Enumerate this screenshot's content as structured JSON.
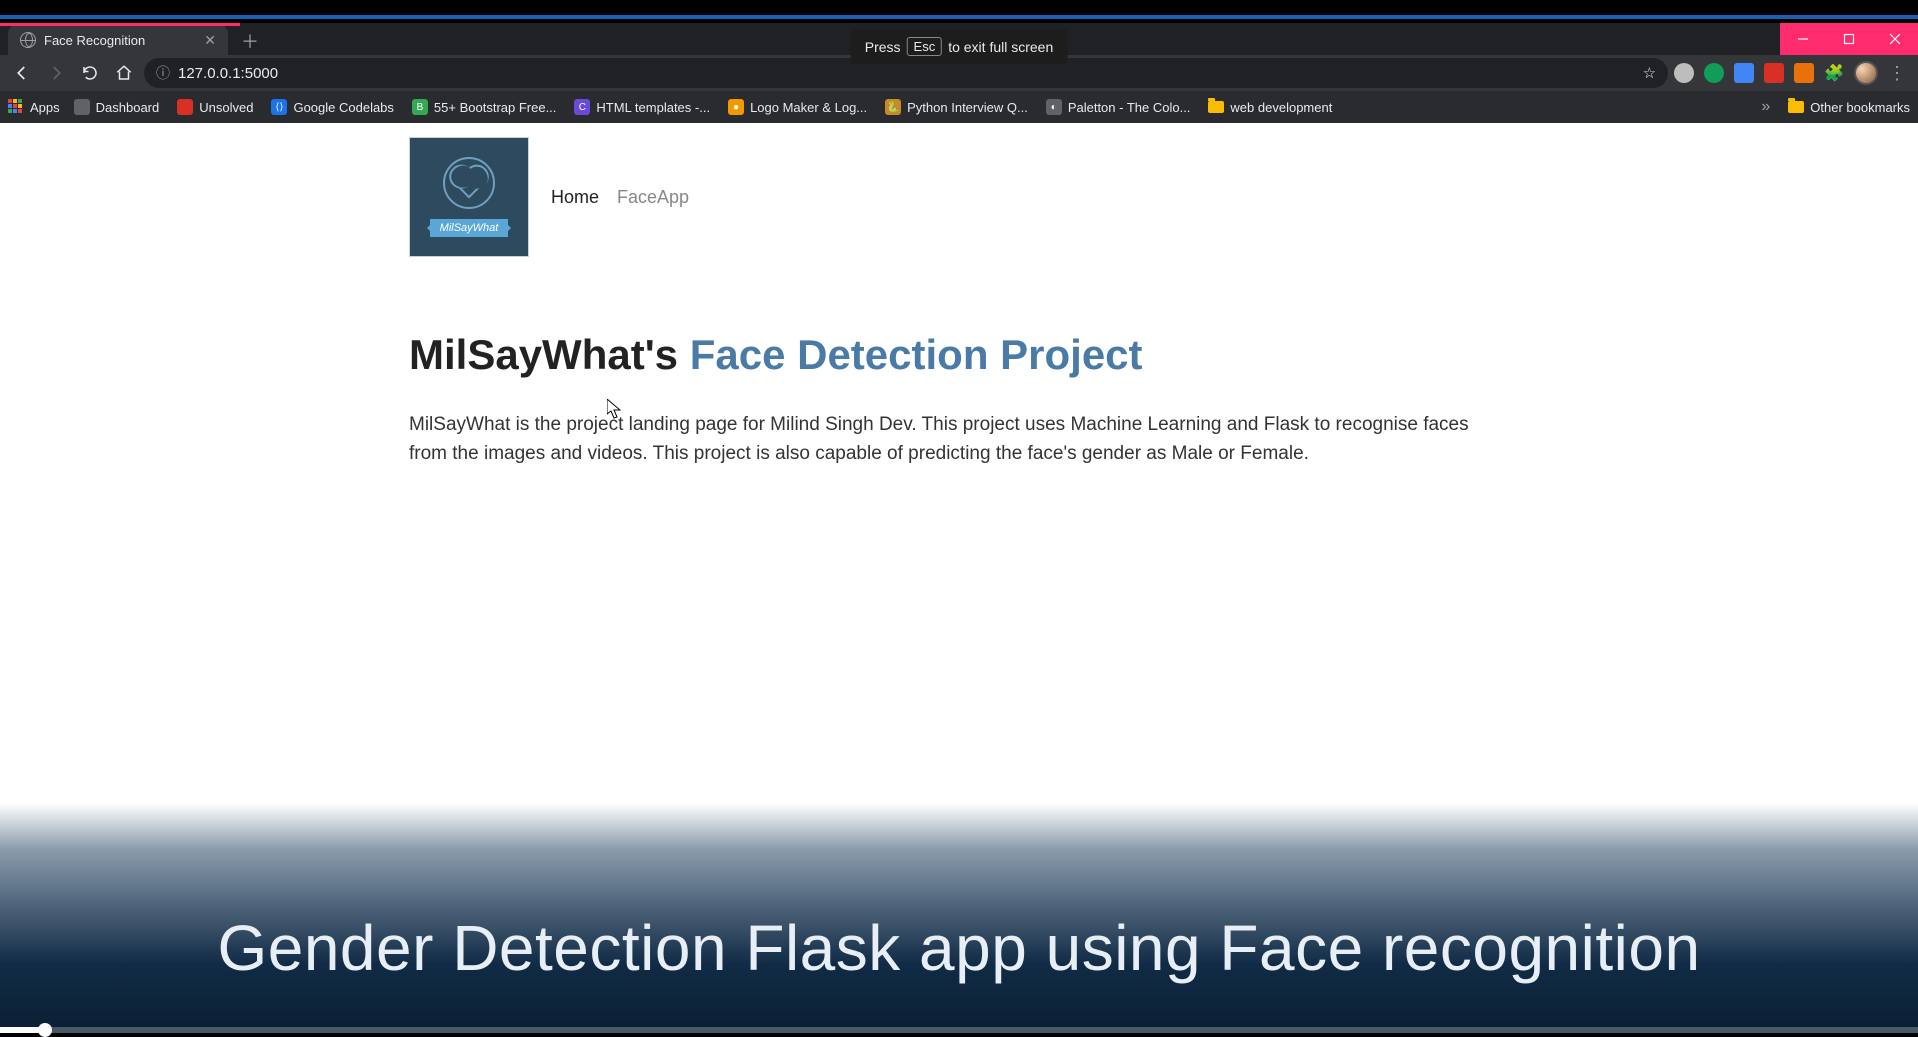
{
  "fullscreen_hint": {
    "pre": "Press",
    "key": "Esc",
    "post": "to exit full screen"
  },
  "tab": {
    "title": "Face Recognition"
  },
  "omnibox": {
    "url": "127.0.0.1:5000"
  },
  "bookmarks_bar": {
    "apps": "Apps",
    "items": [
      {
        "label": "Dashboard",
        "ico_bg": "#5f6368",
        "ico_txt": ""
      },
      {
        "label": "Unsolved",
        "ico_bg": "#d93025",
        "ico_txt": ""
      },
      {
        "label": "Google Codelabs",
        "ico_bg": "#1a73e8",
        "ico_txt": "⟨⟩"
      },
      {
        "label": "55+ Bootstrap Free...",
        "ico_bg": "#34a853",
        "ico_txt": "B"
      },
      {
        "label": "HTML templates -...",
        "ico_bg": "#6a4ad9",
        "ico_txt": "C"
      },
      {
        "label": "Logo Maker & Log...",
        "ico_bg": "#f29900",
        "ico_txt": "●"
      },
      {
        "label": "Python Interview Q...",
        "ico_bg": "#c58a2a",
        "ico_txt": "🐍"
      },
      {
        "label": "Paletton - The Colo...",
        "ico_bg": "#5f6368",
        "ico_txt": "◐"
      },
      {
        "label": "web development",
        "ico_bg": "#fbbc04",
        "ico_txt": "",
        "folder": true
      }
    ],
    "other": "Other bookmarks"
  },
  "page": {
    "logo_text": "MilSayWhat",
    "nav": {
      "home": "Home",
      "faceapp": "FaceApp"
    },
    "title_prefix": "MilSayWhat's ",
    "title_accent": "Face Detection Project",
    "description": "MilSayWhat is the project landing page for Milind Singh Dev. This project uses Machine Learning and Flask to recognise faces from the images and videos. This project is also capable of predicting the face's gender as Male or Female."
  },
  "caption": "Gender Detection Flask app using Face recognition"
}
